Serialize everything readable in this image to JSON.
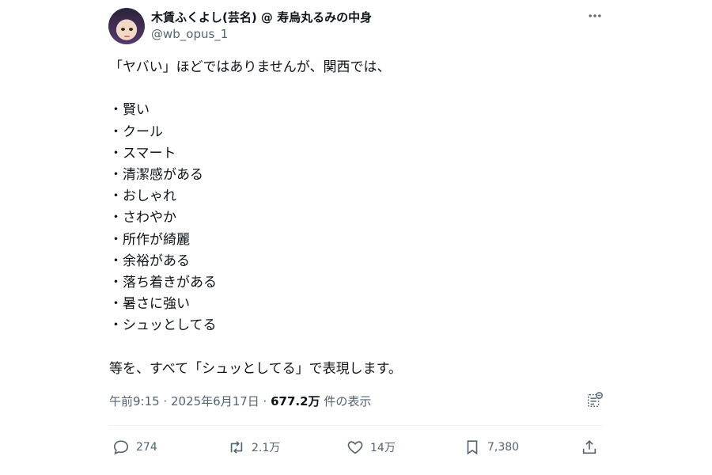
{
  "user": {
    "display_name": "木賃ふくよし(芸名) @ 寿烏丸るみの中身",
    "handle": "@wb_opus_1"
  },
  "tweet": {
    "lines": [
      "「ヤバい」ほどではありませんが、関西では、",
      "",
      "・賢い",
      "・クール",
      "・スマート",
      "・清潔感がある",
      "・おしゃれ",
      "・さわやか",
      "・所作が綺麗",
      "・余裕がある",
      "・落ち着きがある",
      "・暑さに強い",
      "・シュッとしてる",
      "",
      "等を、すべて「シュッとしてる」で表現します。"
    ],
    "timestamp": "午前9:15 · 2025年6月17日 · ",
    "views_count": "677.2万",
    "views_label": " 件の表示"
  },
  "actions": {
    "reply_count": "274",
    "retweet_count": "2.1万",
    "like_count": "14万",
    "bookmark_count": "7,380"
  },
  "icons": {
    "more": "more-icon",
    "reply": "reply-icon",
    "retweet": "retweet-icon",
    "like": "like-icon",
    "bookmark": "bookmark-icon",
    "share": "share-icon",
    "analytics": "analytics-icon"
  },
  "colors": {
    "text": "#0f1419",
    "secondary": "#536471",
    "divider": "#eff3f4"
  }
}
